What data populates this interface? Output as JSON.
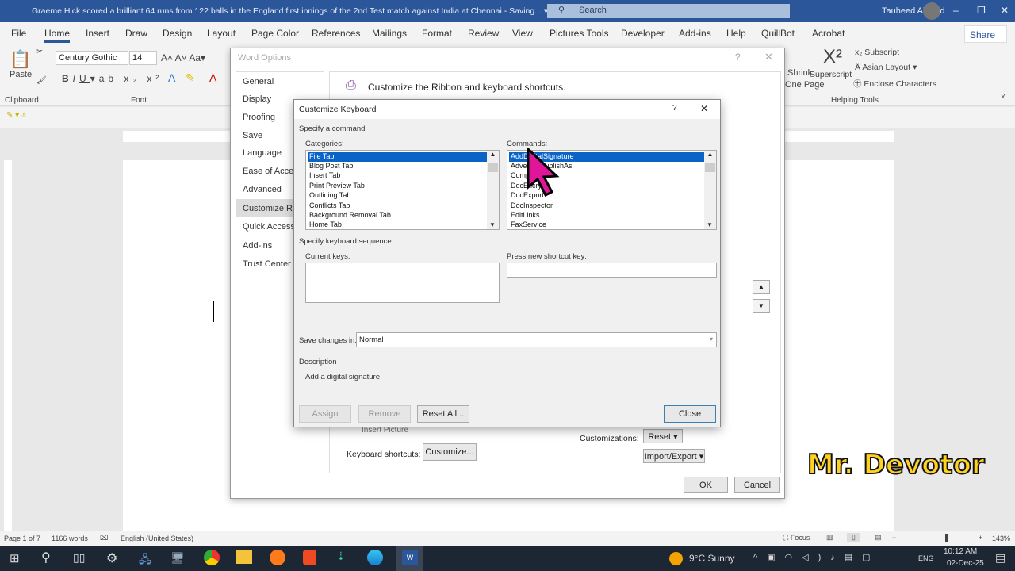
{
  "titlebar": {
    "doc_title": "Graeme Hick scored a brilliant 64 runs from 122 balls in the England first innings of the 2nd Test match against India at Chennai  -  Saving...  ▾",
    "search_placeholder": "Search",
    "user": "Tauheed Ahmed"
  },
  "menu": {
    "tabs": [
      "File",
      "Home",
      "Insert",
      "Draw",
      "Design",
      "Layout",
      "Page Color",
      "References",
      "Mailings",
      "Format",
      "Review",
      "View",
      "Pictures Tools",
      "Developer",
      "Add-ins",
      "Help",
      "QuillBot",
      "Acrobat"
    ],
    "share": "Share"
  },
  "ribbon": {
    "paste": "Paste",
    "font_name": "Century Gothic",
    "font_size": "14",
    "clipboard": "Clipboard",
    "font_group": "Font",
    "shrink": "Shrink",
    "one_page": "One Page",
    "superscript": "Superscript",
    "subscript": "Subscript",
    "asian_layout": "Asian Layout",
    "enclose": "Enclose Characters",
    "helping_tools": "Helping Tools"
  },
  "word_options": {
    "title": "Word Options",
    "nav": [
      "General",
      "Display",
      "Proofing",
      "Save",
      "Language",
      "Ease of Access",
      "Advanced",
      "Customize Ribbon",
      "Quick Access Toolbar",
      "Add-ins",
      "Trust Center"
    ],
    "selected": "Customize Ribbon",
    "heading": "Customize the Ribbon and keyboard shortcuts.",
    "keyboard_shortcuts_label": "Keyboard shortcuts:",
    "customize_button": "Customize...",
    "customizations_label": "Customizations:",
    "reset_button": "Reset",
    "import_export_button": "Import/Export",
    "ok": "OK",
    "cancel": "Cancel",
    "insert_picture": "Insert Picture"
  },
  "customize_keyboard": {
    "title": "Customize Keyboard",
    "help": "?",
    "specify_command": "Specify a command",
    "categories_label": "Categories:",
    "categories": [
      "File Tab",
      "Blog Post Tab",
      "Insert Tab",
      "Print Preview Tab",
      "Outlining Tab",
      "Conflicts Tab",
      "Background Removal Tab",
      "Home Tab"
    ],
    "commands_label": "Commands:",
    "commands": [
      "AddDigitalSignature",
      "AdvertisePublishAs",
      "Compare",
      "DocEncrypt",
      "DocExport",
      "DocInspector",
      "EditLinks",
      "FaxService"
    ],
    "specify_sequence": "Specify keyboard sequence",
    "current_keys_label": "Current keys:",
    "new_key_label": "Press new shortcut key:",
    "new_key_value": "",
    "save_changes_label": "Save changes in:",
    "save_changes_value": "Normal",
    "description_label": "Description",
    "description": "Add a digital signature",
    "assign": "Assign",
    "remove": "Remove",
    "reset_all": "Reset All...",
    "close": "Close"
  },
  "statusbar": {
    "page": "Page 1 of 7",
    "words": "1166 words",
    "language": "English (United States)",
    "focus": "Focus",
    "zoom": "143%"
  },
  "taskbar": {
    "weather": "9°C  Sunny",
    "lang": "ENG",
    "time": "10:12 AM",
    "date": "02-Dec-25"
  },
  "watermark": "Mr. Devotor",
  "colors": {
    "accent": "#2b579a",
    "selection": "#0a64c8",
    "cursor": "#e0169a"
  }
}
